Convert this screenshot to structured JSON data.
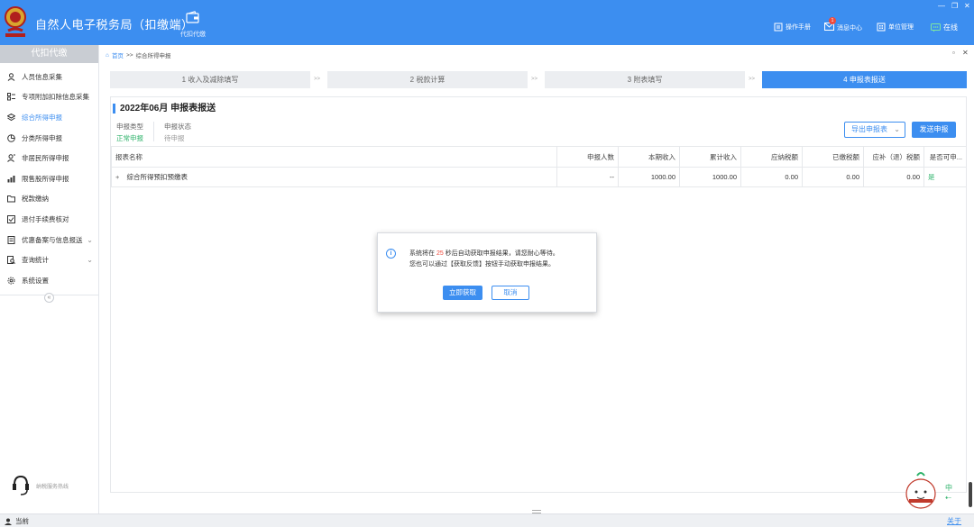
{
  "header": {
    "app_title": "自然人电子税务局（扣缴端）",
    "tab_label": "代扣代缴",
    "right_items": [
      {
        "icon": "book-icon",
        "label": "操作手册"
      },
      {
        "icon": "mail-icon",
        "label": "消息中心",
        "badge": "1"
      },
      {
        "icon": "building-icon",
        "label": "单位管理"
      },
      {
        "icon": "chat-icon",
        "label": "在线"
      }
    ]
  },
  "sidebar": {
    "title": "代扣代缴",
    "items": [
      {
        "label": "人员信息采集",
        "icon": "person-icon"
      },
      {
        "label": "专项附加扣除信息采集",
        "icon": "list-icon"
      },
      {
        "label": "综合所得申报",
        "icon": "layers-icon",
        "active": true
      },
      {
        "label": "分类所得申报",
        "icon": "pie-icon"
      },
      {
        "label": "非居民所得申报",
        "icon": "user-icon"
      },
      {
        "label": "限售股所得申报",
        "icon": "bar-chart-icon"
      },
      {
        "label": "税款缴纳",
        "icon": "folder-icon"
      },
      {
        "label": "退付手续费核对",
        "icon": "doc-check-icon"
      },
      {
        "label": "优惠备案与信息报送",
        "icon": "doc-icon",
        "expandable": true
      },
      {
        "label": "查询统计",
        "icon": "search-doc-icon",
        "expandable": true
      },
      {
        "label": "系统设置",
        "icon": "gear-icon"
      }
    ],
    "hotline_label": "纳税服务热线"
  },
  "breadcrumb": {
    "home": "首页",
    "separator": ">>",
    "current": "综合所得申报"
  },
  "steps": [
    {
      "label": "1 收入及减除填写"
    },
    {
      "label": "2 税款计算"
    },
    {
      "label": "3 附表填写"
    },
    {
      "label": "4 申报表报送",
      "active": true
    }
  ],
  "step_separator": ">>",
  "report": {
    "period_title": "2022年06月  申报表报送",
    "type_label": "申报类型",
    "type_value": "正常申报",
    "status_label": "申报状态",
    "status_value": "待申报",
    "export_button": "导出申报表",
    "send_button": "发送申报"
  },
  "table": {
    "columns": [
      "报表名称",
      "申报人数",
      "本期收入",
      "累计收入",
      "应纳税额",
      "已缴税额",
      "应补（退）税额",
      "是否可申..."
    ],
    "rows": [
      {
        "expander": "+",
        "name": "综合所得预扣预缴表",
        "people": "--",
        "income": "1000.00",
        "cumulative": "1000.00",
        "tax_due": "0.00",
        "tax_paid": "0.00",
        "tax_diff": "0.00",
        "can_declare": "是"
      }
    ]
  },
  "dialog": {
    "line1_prefix": "系统将在",
    "countdown": "25",
    "line1_suffix": "秒后自动获取申报结果，请您耐心等待。",
    "line2": "您也可以通过【获取反馈】按钮手动获取申报结果。",
    "ok_button": "立即获取",
    "cancel_button": "取消"
  },
  "assistant": {
    "side_label_1": "中",
    "side_label_2": "⇠"
  },
  "statusbar": {
    "left_label": "当前",
    "right_link": "关于"
  },
  "colors": {
    "primary": "#3c8ef0",
    "green": "#2fb36b",
    "alert": "#f04a3c"
  }
}
